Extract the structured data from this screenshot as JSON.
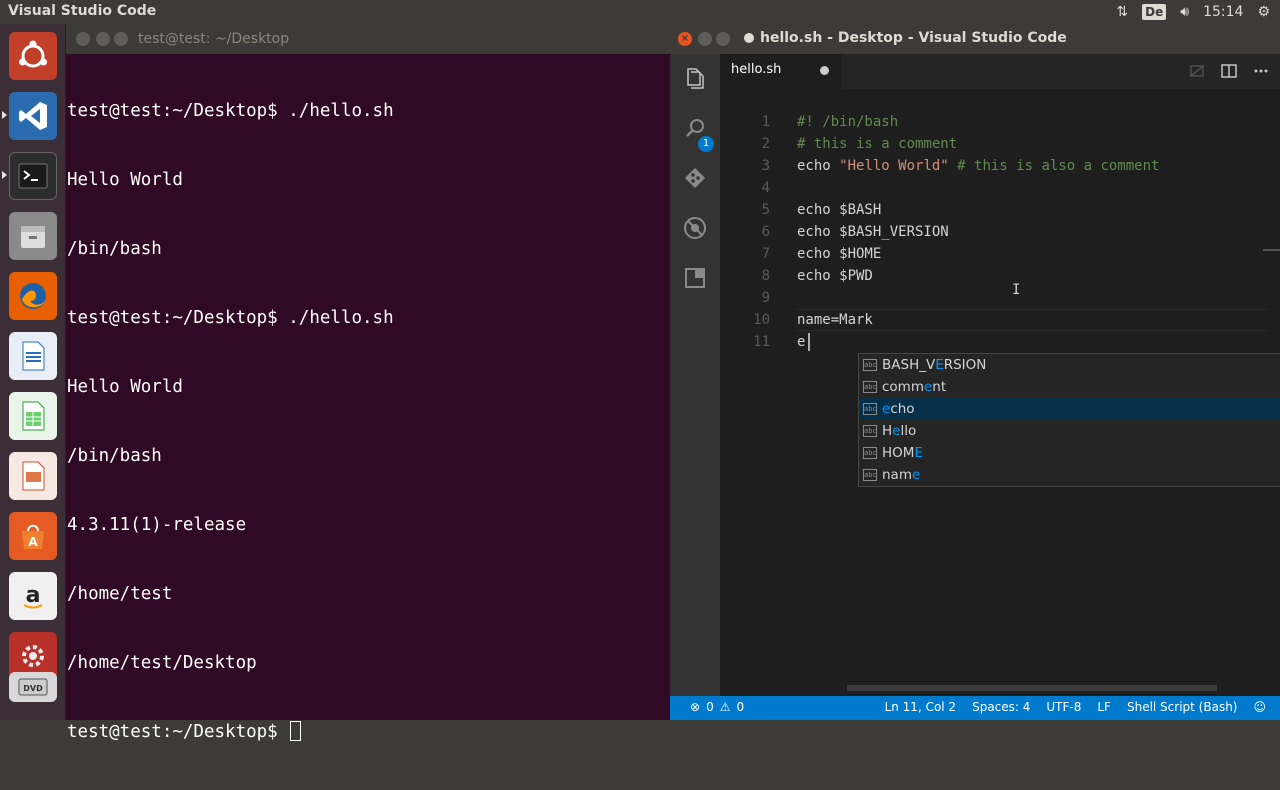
{
  "top_panel": {
    "app_title": "Visual Studio Code",
    "keyboard_layout": "De",
    "clock": "15:14"
  },
  "terminal": {
    "title": "test@test: ~/Desktop",
    "lines": [
      "test@test:~/Desktop$ ./hello.sh",
      "Hello World",
      "/bin/bash",
      "test@test:~/Desktop$ ./hello.sh",
      "Hello World",
      "/bin/bash",
      "4.3.11(1)-release",
      "/home/test",
      "/home/test/Desktop"
    ],
    "prompt": "test@test:~/Desktop$ "
  },
  "vscode": {
    "window_title": "hello.sh - Desktop - Visual Studio Code",
    "tab_label": "hello.sh",
    "explorer_badge": "1",
    "code_lines": [
      {
        "n": "1",
        "text": "#! /bin/bash",
        "kind": "comment"
      },
      {
        "n": "2",
        "text": "# this is a comment",
        "kind": "comment"
      },
      {
        "n": "3",
        "text": "echo ",
        "kind": "mixed",
        "string": "\"Hello World\"",
        "comment": " # this is also a comment"
      },
      {
        "n": "4",
        "text": "",
        "kind": "plain"
      },
      {
        "n": "5",
        "text": "echo $BASH",
        "kind": "plain"
      },
      {
        "n": "6",
        "text": "echo $BASH_VERSION",
        "kind": "plain"
      },
      {
        "n": "7",
        "text": "echo $HOME",
        "kind": "plain"
      },
      {
        "n": "8",
        "text": "echo $PWD",
        "kind": "plain"
      },
      {
        "n": "9",
        "text": "",
        "kind": "plain"
      },
      {
        "n": "10",
        "text": "name=Mark",
        "kind": "plain"
      },
      {
        "n": "11",
        "text": "e",
        "kind": "plain"
      }
    ],
    "suggestions": [
      {
        "pre": "BASH_V",
        "hl": "E",
        "post": "RSION",
        "selected": false
      },
      {
        "pre": "comm",
        "hl": "e",
        "post": "nt",
        "selected": false
      },
      {
        "pre": "",
        "hl": "e",
        "post": "cho",
        "selected": true
      },
      {
        "pre": "H",
        "hl": "e",
        "post": "llo",
        "selected": false
      },
      {
        "pre": "HOM",
        "hl": "E",
        "post": "",
        "selected": false
      },
      {
        "pre": "nam",
        "hl": "e",
        "post": "",
        "selected": false
      }
    ],
    "status": {
      "errors": "0",
      "warnings": "0",
      "position": "Ln 11, Col 2",
      "spaces": "Spaces: 4",
      "encoding": "UTF-8",
      "eol": "LF",
      "language": "Shell Script (Bash)"
    }
  },
  "colors": {
    "terminal_bg": "#300a24",
    "editor_bg": "#1e1e1e",
    "status_bg": "#007acc",
    "launcher_bg": "#3b2e36"
  }
}
